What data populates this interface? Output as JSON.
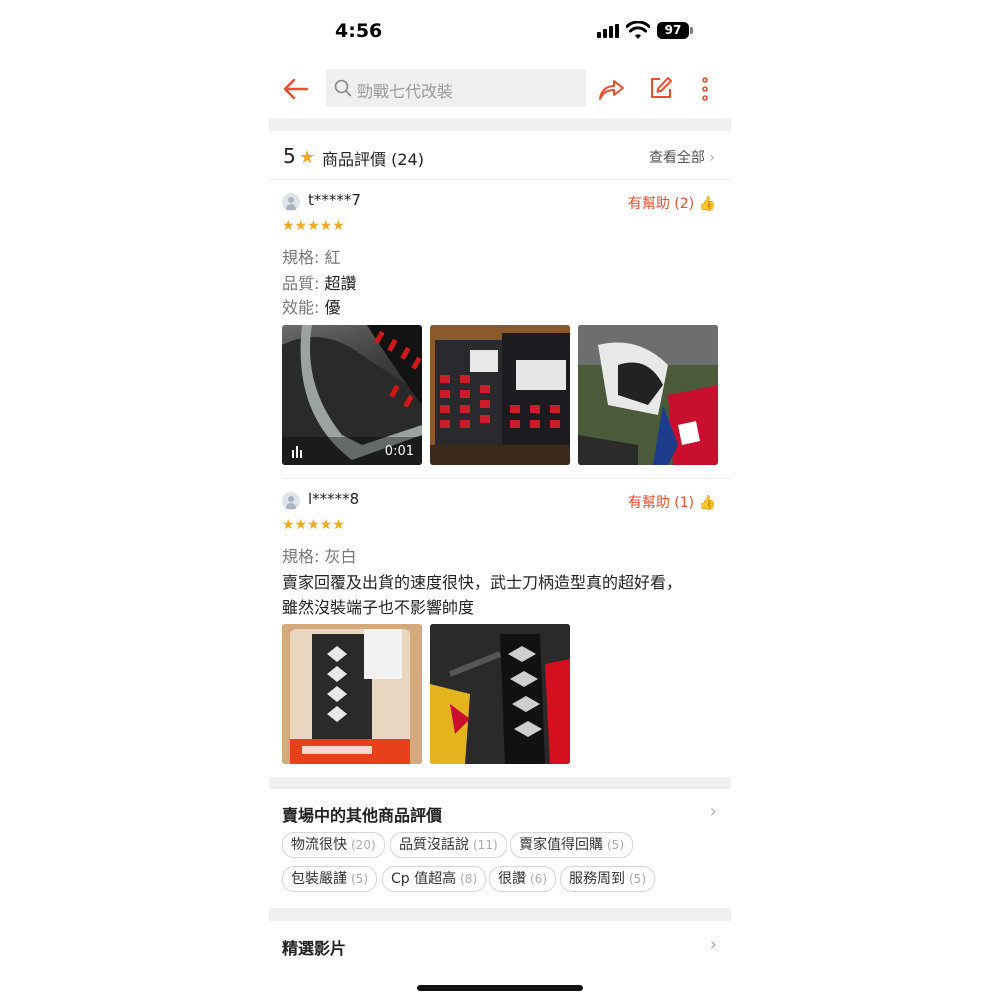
{
  "status_bar": {
    "time": "4:56",
    "battery": "97"
  },
  "search": {
    "placeholder": "勁戰七代改裝"
  },
  "rating_header": {
    "score": "5",
    "title": "商品評價 (24)",
    "see_all": "查看全部"
  },
  "reviews": [
    {
      "user": "t*****7",
      "helpful": "有幫助 (2)",
      "stars": "★★★★★",
      "lines": [
        {
          "key": "規格: ",
          "value": "紅"
        },
        {
          "key": "品質: ",
          "value": "超讚"
        },
        {
          "key": "效能: ",
          "value": "優"
        }
      ],
      "video_duration": "0:01"
    },
    {
      "user": "l*****8",
      "helpful": "有幫助 (1)",
      "stars": "★★★★★",
      "spec": {
        "key": "規格: ",
        "value": "灰白"
      },
      "comment_line1": "賣家回覆及出貨的速度很快，武士刀柄造型真的超好看，",
      "comment_line2": "雖然沒裝端子也不影響帥度"
    }
  ],
  "shop_reviews": {
    "title": "賣場中的其他商品評價",
    "tags": [
      {
        "label": "物流很快",
        "count": "(20)"
      },
      {
        "label": "品質沒話說",
        "count": "(11)"
      },
      {
        "label": "賣家值得回購",
        "count": "(5)"
      },
      {
        "label": "包裝嚴謹",
        "count": "(5)"
      },
      {
        "label": "Cp 值超高",
        "count": "(8)"
      },
      {
        "label": "很讚",
        "count": "(6)"
      },
      {
        "label": "服務周到",
        "count": "(5)"
      }
    ]
  },
  "featured": {
    "title": "精選影片"
  },
  "colors": {
    "accent": "#ee4d2d",
    "star": "#f5a623"
  },
  "icons": [
    "back-arrow-icon",
    "search-icon",
    "share-icon",
    "edit-icon",
    "more-icon",
    "thumb-up-icon",
    "chevron-right-icon"
  ]
}
